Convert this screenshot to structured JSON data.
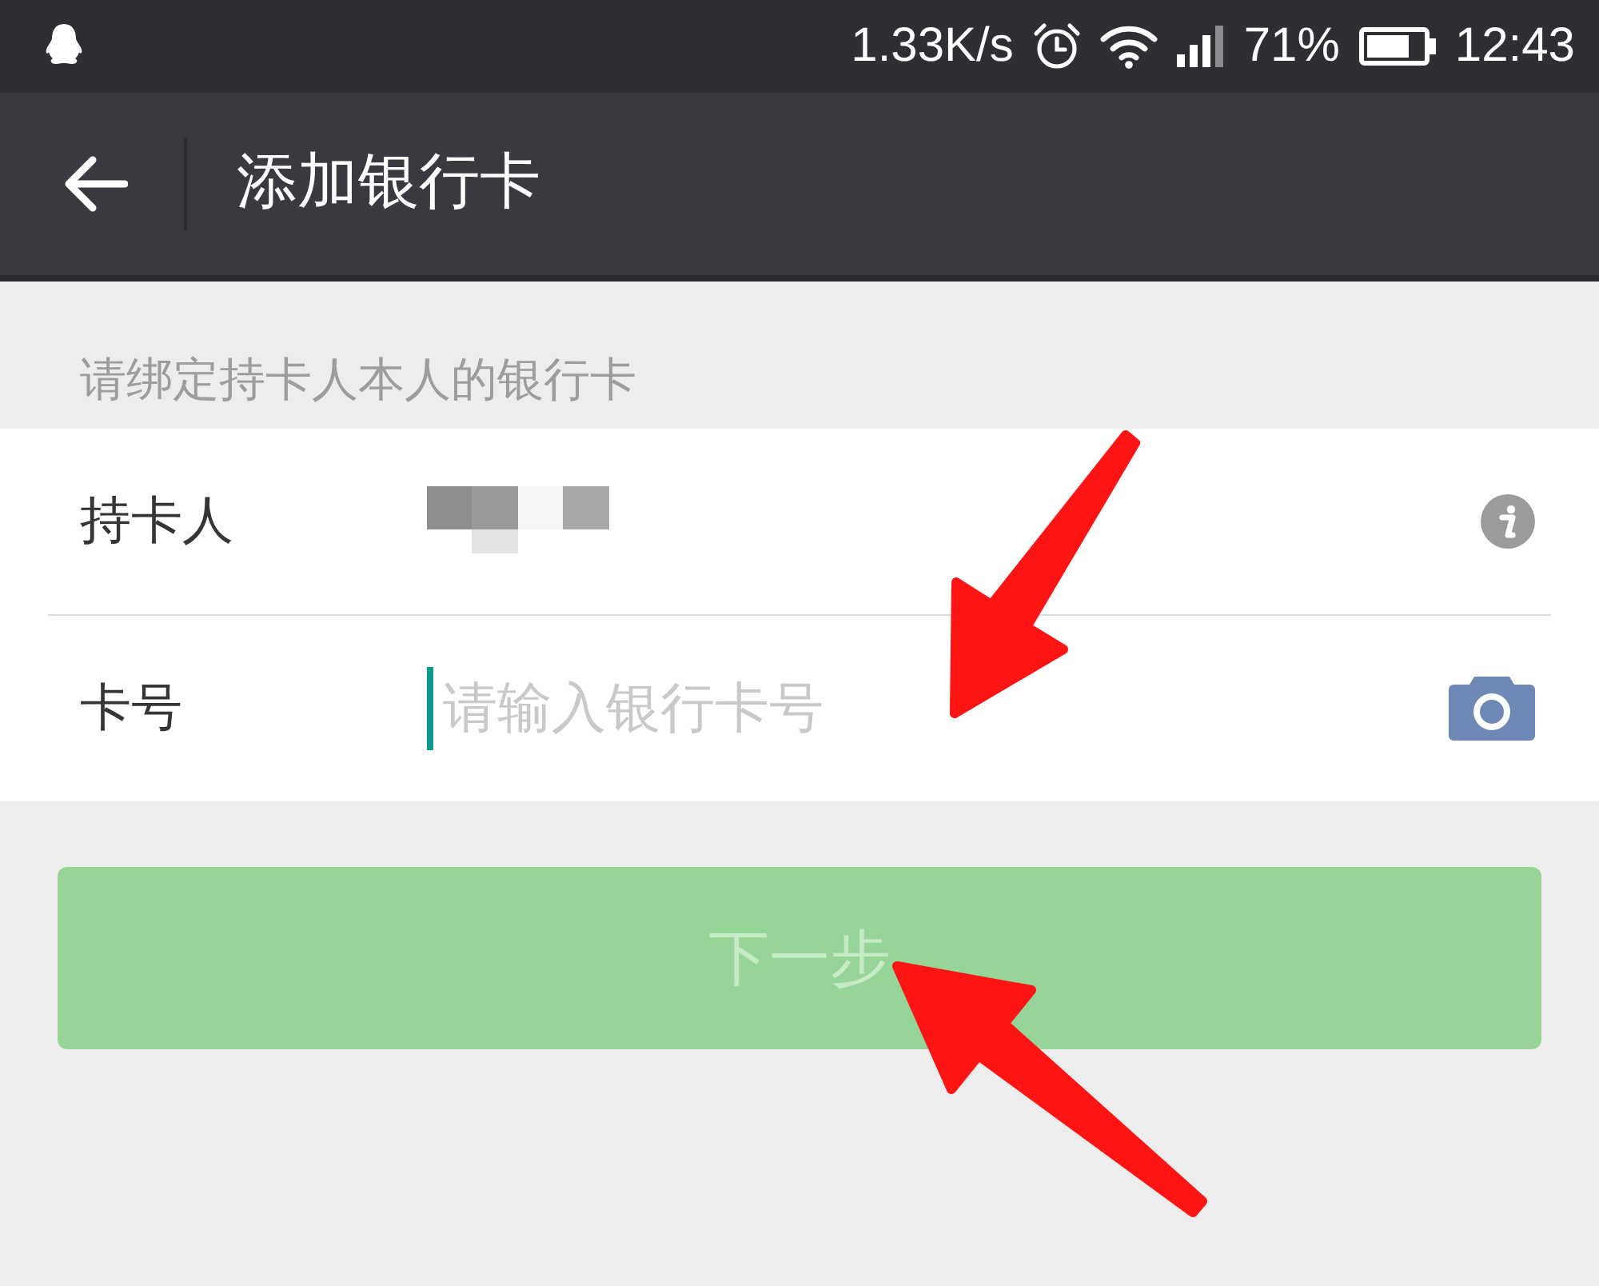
{
  "status_bar": {
    "network_speed": "1.33K/s",
    "battery": "71%",
    "time": "12:43"
  },
  "header": {
    "title": "添加银行卡"
  },
  "hint": "请绑定持卡人本人的银行卡",
  "form": {
    "rows": [
      {
        "kind": "holder",
        "label": "持卡人",
        "redacted": true
      },
      {
        "kind": "input",
        "label": "卡号",
        "placeholder": "请输入银行卡号",
        "focused": true,
        "annotated": true
      }
    ]
  },
  "next_button": {
    "label": "下一步",
    "disabled": true,
    "annotated": true
  }
}
